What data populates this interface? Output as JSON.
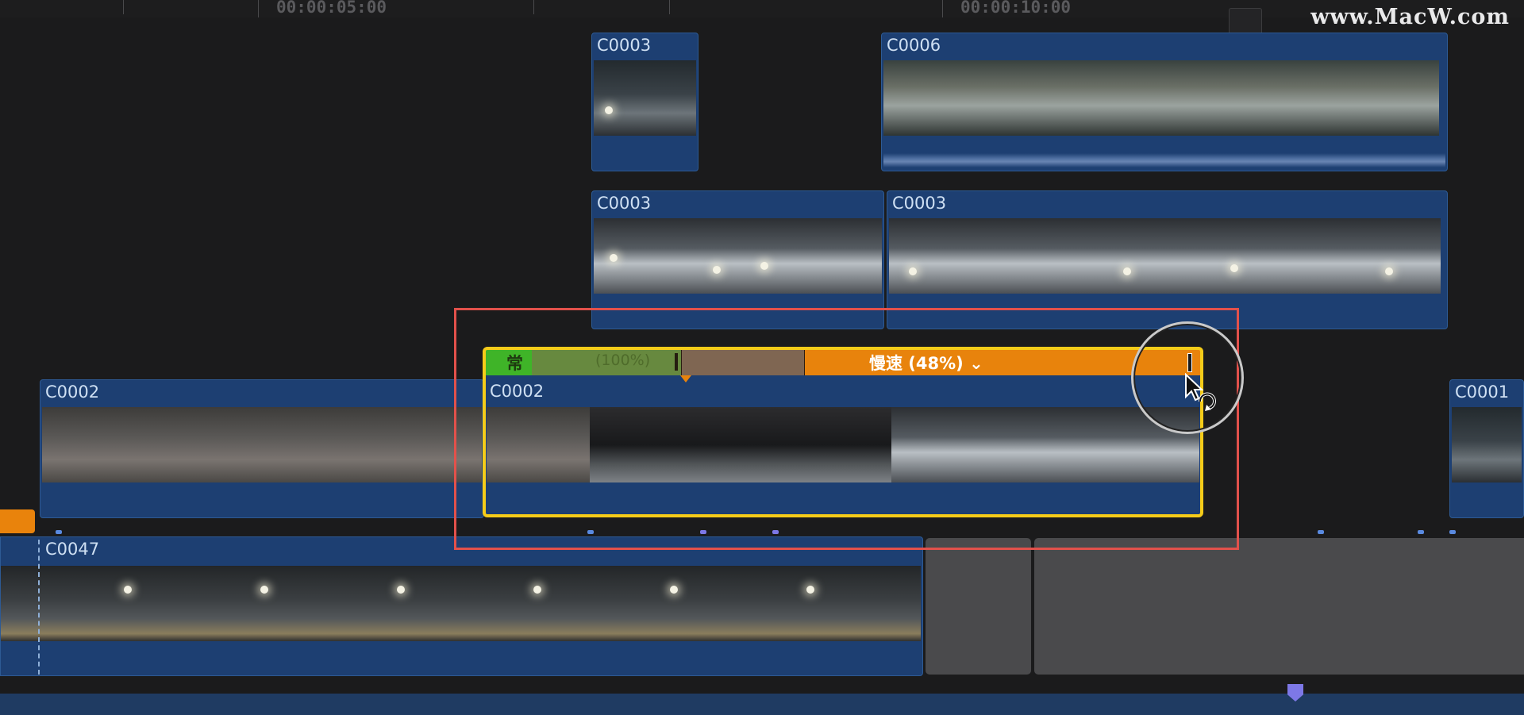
{
  "ruler": {
    "timecodes": [
      "00:00:05:00",
      "00:00:10:00"
    ]
  },
  "watermark": "www.MacW.com",
  "clips": {
    "c0003_top": "C0003",
    "c0006": "C0006",
    "c0003_mid_a": "C0003",
    "c0003_mid_b": "C0003",
    "c0002_left": "C0002",
    "c0002_selected": "C0002",
    "c0001": "C0001",
    "c0047": "C0047"
  },
  "retime": {
    "normal_label": "常",
    "normal_100": "(100%)",
    "slow_label": "慢速 (48%)",
    "chevron": "⌄"
  },
  "colors": {
    "clip_blue": "#1d3f72",
    "speed_orange": "#e8830c",
    "speed_green": "#3fb428",
    "selection_yellow": "#f5cc19",
    "highlight_red": "#e2514b",
    "playhead_marker": "#7d78e6"
  },
  "icons": {
    "cursor": "retime-cursor-icon",
    "marker": "timeline-marker-icon"
  }
}
